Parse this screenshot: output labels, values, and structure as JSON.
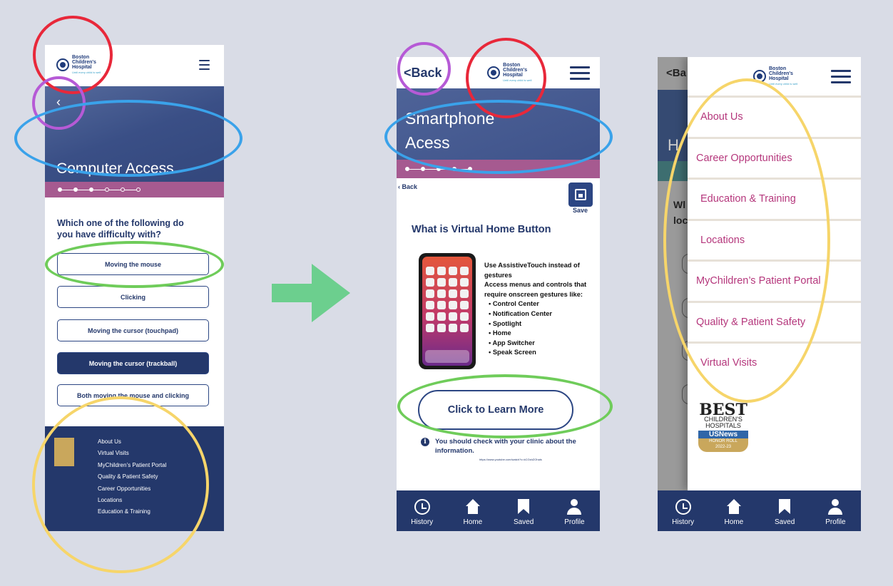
{
  "logo": {
    "line1": "Boston",
    "line2": "Children's",
    "line3": "Hospital",
    "tagline": "Until every child is well"
  },
  "screen1": {
    "back_glyph": "‹",
    "title": "Computer Access",
    "question": "Which one of the following do you have difficulty with?",
    "options": [
      "Moving the mouse",
      "Clicking",
      "Moving the cursor (touchpad)",
      "Moving the cursor (trackball)",
      "Both moving the mouse and clicking"
    ],
    "selected_option": 3,
    "footer_links": [
      "About Us",
      "Virtual Visits",
      "MyChildren’s Patient Portal",
      "Quality & Patient Safety",
      "Career Opportunities",
      "Locations",
      "Education & Training"
    ]
  },
  "screen2": {
    "back_label": "<Back",
    "title": "Smartphone Acess",
    "small_back": "‹ Back",
    "save_label": "Save",
    "heading": "What is Virtual Home Button",
    "desc_intro": "Use AssistiveTouch instead of gestures",
    "desc_body": "Access menus and controls that require onscreen gestures like:",
    "desc_items": [
      "Control Center",
      "Notification Center",
      "Spotlight",
      "Home",
      "App Switcher",
      "Speak Screen"
    ],
    "learn_more": "Click to Learn More",
    "note": "You should check with your clinic about the information.",
    "url": "https://www.youtube.com/watch?v=kCGshZOhals"
  },
  "screen3": {
    "under_back": "<Ba",
    "under_hero_letter": "H",
    "under_question": "Wl loc",
    "menu_items": [
      "About Us",
      "Career Opportunities",
      "Education & Training",
      "Locations",
      "MyChildren’s Patient Portal",
      "Quality & Patient Safety",
      "Virtual Visits"
    ],
    "badge": {
      "best": "BEST",
      "line1": "CHILDREN'S",
      "line2": "HOSPITALS",
      "news": "USNews",
      "roll": "HONOR ROLL",
      "year": "2022-23"
    }
  },
  "tabbar": [
    {
      "label": "History",
      "icon": "history-icon"
    },
    {
      "label": "Home",
      "icon": "home-icon"
    },
    {
      "label": "Saved",
      "icon": "bookmark-icon"
    },
    {
      "label": "Profile",
      "icon": "profile-icon"
    }
  ],
  "colors": {
    "background": "#d9dce6",
    "navy": "#24386b",
    "magenta": "#a65a90",
    "menu_text": "#b5377c",
    "arrow": "#6ccf8e",
    "ring_red": "#e8283a",
    "ring_purple": "#b65ad6",
    "ring_blue": "#3aa2ea",
    "ring_green": "#6fcc5a",
    "ring_yellow": "#f6d56a"
  }
}
